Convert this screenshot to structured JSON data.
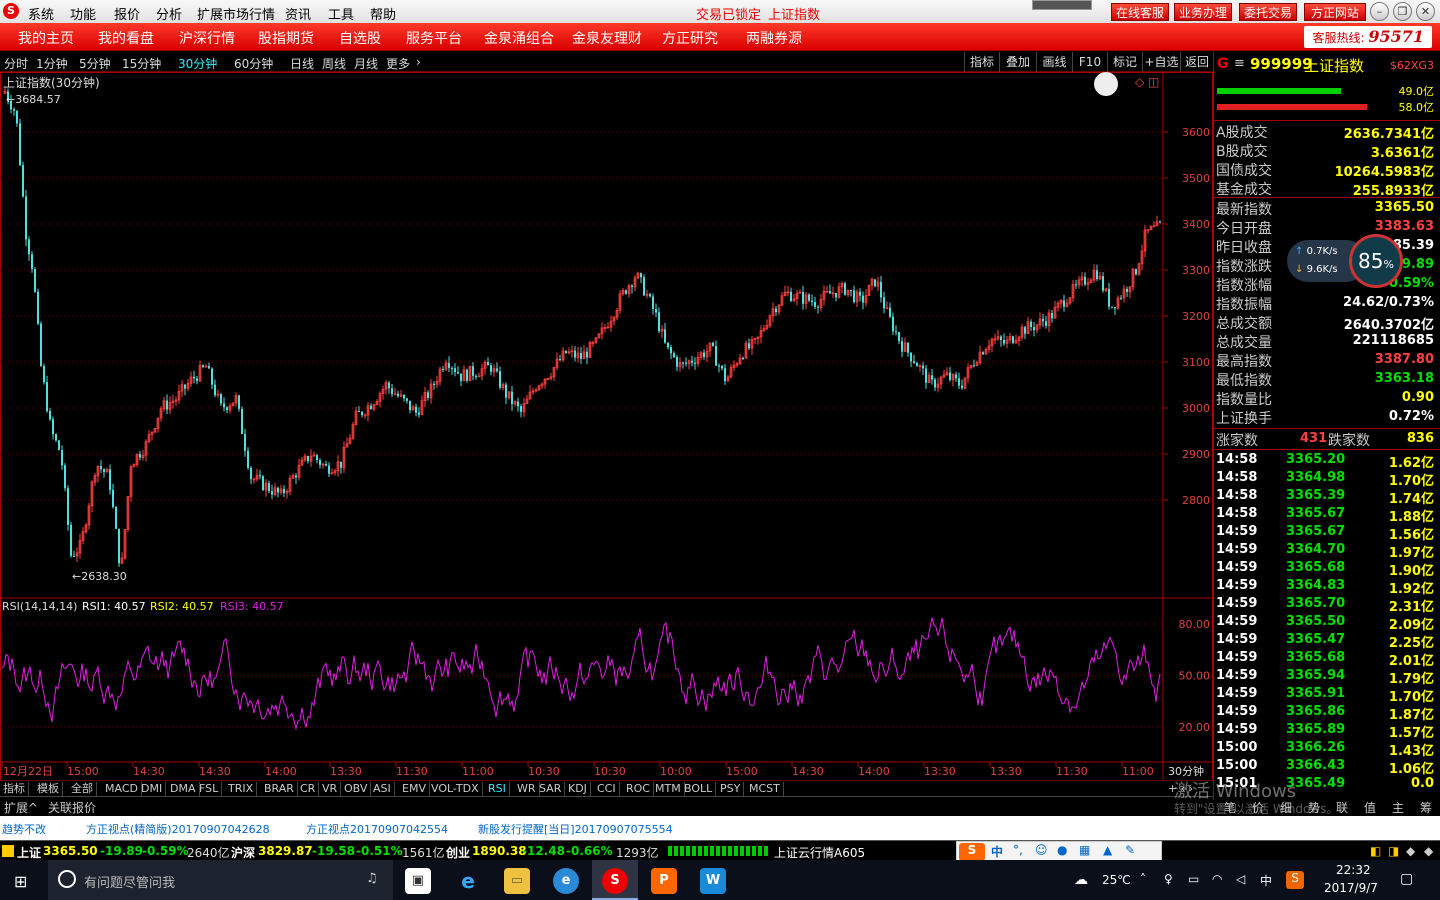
{
  "menubar": {
    "items": [
      "系统",
      "功能",
      "报价",
      "分析",
      "扩展市场行情",
      "资讯",
      "工具",
      "帮助"
    ],
    "status": "交易已锁定",
    "current": "上证指数",
    "buttons": [
      "在线客服",
      "业务办理",
      "委托交易",
      "方正网站"
    ]
  },
  "navbar": {
    "items": [
      "我的主页",
      "我的看盘",
      "沪深行情",
      "股指期货",
      "自选股",
      "服务平台",
      "金泉涌组合",
      "金泉友理财",
      "方正研究",
      "两融券源"
    ],
    "hotline_label": "客服热线:",
    "hotline_number": "95571"
  },
  "periods": {
    "items": [
      "分时",
      "1分钟",
      "5分钟",
      "15分钟",
      "30分钟",
      "60分钟",
      "日线",
      "周线",
      "月线",
      "更多"
    ],
    "selected": "30分钟"
  },
  "toolbar": [
    "指标",
    "叠加",
    "画线",
    "F10",
    "标记",
    "+自选",
    "返回"
  ],
  "chart": {
    "title": "上证指数(30分钟)",
    "high_label": "3684.57",
    "low_label": "2638.30",
    "yticks": [
      "3600",
      "3500",
      "3400",
      "3300",
      "3200",
      "3100",
      "3000",
      "2900",
      "2800"
    ],
    "xticks": [
      "12月22日",
      "15:00",
      "14:30",
      "14:30",
      "14:00",
      "13:30",
      "11:30",
      "11:00",
      "10:30",
      "10:30",
      "10:00",
      "15:00",
      "14:30",
      "14:00",
      "13:30",
      "13:30",
      "11:30",
      "11:00"
    ],
    "period_label": "30分钟"
  },
  "rsi": {
    "title": "RSI(14,14,14)",
    "rsi1_label": "RSI1: 40.57",
    "rsi2_label": "RSI2: 40.57",
    "rsi3_label": "RSI3: 40.57",
    "yticks": [
      "80.00",
      "50.00",
      "20.00"
    ]
  },
  "indicators": {
    "items": [
      "指标",
      "模板",
      "全部",
      "MACD",
      "DMI",
      "DMA",
      "FSL",
      "TRIX",
      "BRAR",
      "CR",
      "VR",
      "OBV",
      "ASI",
      "EMV",
      "VOL-TDX",
      "RSI",
      "WR",
      "SAR",
      "KDJ",
      "CCI",
      "ROC",
      "MTM",
      "BOLL",
      "PSY",
      "MCST"
    ],
    "selected": "RSI"
  },
  "extbar": {
    "items": [
      "扩展^",
      "关联报价"
    ],
    "right_tabs": [
      "笔",
      "价",
      "细",
      "势",
      "联",
      "值",
      "主",
      "筹"
    ]
  },
  "sidebar": {
    "code": "999999",
    "name": "上证指数",
    "tag": "$62XG3",
    "bar1": "49.0亿",
    "bar2": "58.0亿",
    "turnover": [
      {
        "k": "A股成交",
        "v": "2636.7341亿"
      },
      {
        "k": "B股成交",
        "v": "3.6361亿"
      },
      {
        "k": "国债成交",
        "v": "10264.5983亿"
      },
      {
        "k": "基金成交",
        "v": "255.8933亿"
      }
    ],
    "stats": [
      {
        "k": "最新指数",
        "v": "3365.50",
        "c": "yellow"
      },
      {
        "k": "今日开盘",
        "v": "3383.63",
        "c": "red"
      },
      {
        "k": "昨日收盘",
        "v": "3385.39",
        "c": ""
      },
      {
        "k": "指数涨跌",
        "v": "-19.89",
        "c": "green"
      },
      {
        "k": "指数涨幅",
        "v": "-0.59%",
        "c": "green"
      },
      {
        "k": "指数振幅",
        "v": "24.62/0.73%",
        "c": ""
      },
      {
        "k": "总成交额",
        "v": "2640.3702亿",
        "c": ""
      },
      {
        "k": "总成交量",
        "v": "221118685",
        "c": ""
      },
      {
        "k": "最高指数",
        "v": "3387.80",
        "c": "red"
      },
      {
        "k": "最低指数",
        "v": "3363.18",
        "c": "green"
      },
      {
        "k": "指数量比",
        "v": "0.90",
        "c": "yellow"
      },
      {
        "k": "上证换手",
        "v": "0.72%",
        "c": ""
      }
    ],
    "up_label": "涨家数",
    "up": "431",
    "down_label": "跌家数",
    "down": "836",
    "ticks": [
      {
        "t": "14:58",
        "p": "3365.20",
        "a": "1.62亿"
      },
      {
        "t": "14:58",
        "p": "3364.98",
        "a": "1.70亿"
      },
      {
        "t": "14:58",
        "p": "3365.39",
        "a": "1.74亿"
      },
      {
        "t": "14:58",
        "p": "3365.67",
        "a": "1.88亿"
      },
      {
        "t": "14:59",
        "p": "3365.67",
        "a": "1.56亿"
      },
      {
        "t": "14:59",
        "p": "3364.70",
        "a": "1.97亿"
      },
      {
        "t": "14:59",
        "p": "3365.68",
        "a": "1.90亿"
      },
      {
        "t": "14:59",
        "p": "3364.83",
        "a": "1.92亿"
      },
      {
        "t": "14:59",
        "p": "3365.70",
        "a": "2.31亿"
      },
      {
        "t": "14:59",
        "p": "3365.50",
        "a": "2.09亿"
      },
      {
        "t": "14:59",
        "p": "3365.47",
        "a": "2.25亿"
      },
      {
        "t": "14:59",
        "p": "3365.68",
        "a": "2.01亿"
      },
      {
        "t": "14:59",
        "p": "3365.94",
        "a": "1.79亿"
      },
      {
        "t": "14:59",
        "p": "3365.91",
        "a": "1.70亿"
      },
      {
        "t": "14:59",
        "p": "3365.86",
        "a": "1.87亿"
      },
      {
        "t": "14:59",
        "p": "3365.89",
        "a": "1.57亿"
      },
      {
        "t": "15:00",
        "p": "3366.26",
        "a": "1.43亿"
      },
      {
        "t": "15:00",
        "p": "3366.43",
        "a": "1.06亿"
      },
      {
        "t": "15:01",
        "p": "3365.49",
        "a": "0.0"
      }
    ],
    "speed": {
      "up": "0.7K/s",
      "down": "9.6K/s",
      "pct": "85",
      "pct_sign": "%"
    },
    "watermark1": "激活 Windows",
    "watermark2": "转到\"设置\"以激活 Windows。"
  },
  "news": [
    "趋势不改",
    "方正视点(精简版)20170907042628",
    "方正视点20170907042554",
    "新股发行提醒[当日]20170907075554"
  ],
  "ticker": {
    "sh_label": "上证",
    "sh_price": "3365.50",
    "sh_chg": "-19.89",
    "sh_pct": "-0.59%",
    "sh_amt": "2640亿",
    "hs_label": "沪深",
    "hs_price": "3829.87",
    "hs_chg": "-19.58",
    "hs_pct": "-0.51%",
    "hs_amt": "1561亿",
    "cy_label": "创业",
    "cy_price": "1890.38",
    "cy_chg": "-12.48",
    "cy_pct": "-0.66%",
    "cy_amt": "1293亿",
    "cloud": "上证云行情A605"
  },
  "ime": {
    "lang": "中",
    "punct": "°,"
  },
  "taskbar": {
    "search_placeholder": "有问题尽管问我",
    "weather": "25℃",
    "ime": "中",
    "time": "22:32",
    "date": "2017/9/7"
  },
  "colors": {
    "accent_red": "#d90000",
    "up": "#ff4040",
    "down": "#00e000",
    "rsi": "#e020e0",
    "candle_down": "#4fe0e0"
  }
}
